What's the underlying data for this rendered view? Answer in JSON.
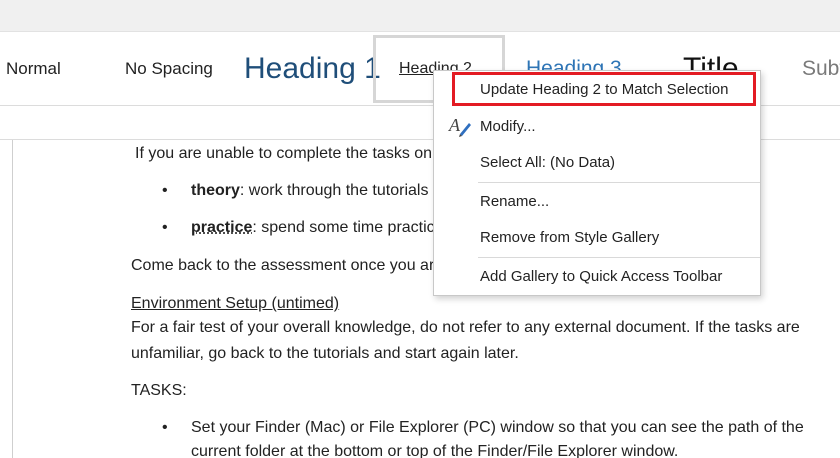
{
  "ribbon": {
    "styles": [
      {
        "label": "Normal"
      },
      {
        "label": "No Spacing"
      },
      {
        "label": "Heading 1"
      },
      {
        "label": "Heading 2"
      },
      {
        "label": "Heading 3"
      },
      {
        "label": "Title"
      },
      {
        "label": "Subtitle"
      }
    ]
  },
  "document": {
    "line1": "If you are unable to complete the tasks on your own, or if you feel you need both",
    "bullet1_term": "theory",
    "bullet1_text": ": work through the tutorials again",
    "bullet2_term": "practice",
    "bullet2_text": ": spend some time practicing what you have learnt on your computer",
    "line4": "Come back to the assessment once you are ready.",
    "env_heading": "Environment Setup (untimed)",
    "para_line1": "For a fair test of your overall knowledge, do not refer to any external document. If the tasks are",
    "para_line2": "unfamiliar, go back to the tutorials and start again later.",
    "tasks_label": "TASKS:",
    "task1_line1": "Set your Finder (Mac) or File Explorer (PC) window so that you can see the path of the",
    "task1_line2": "current folder at the bottom or top of the Finder/File Explorer window."
  },
  "context_menu": {
    "items": [
      {
        "label": "Update Heading 2 to Match Selection",
        "highlighted": true
      },
      {
        "label": "Modify...",
        "icon": "style-pen-icon"
      },
      {
        "label": "Select All: (No Data)"
      },
      {
        "label": "Rename..."
      },
      {
        "label": "Remove from Style Gallery"
      },
      {
        "label": "Add Gallery to Quick Access Toolbar"
      }
    ],
    "highlight_color": "#e31b23"
  }
}
